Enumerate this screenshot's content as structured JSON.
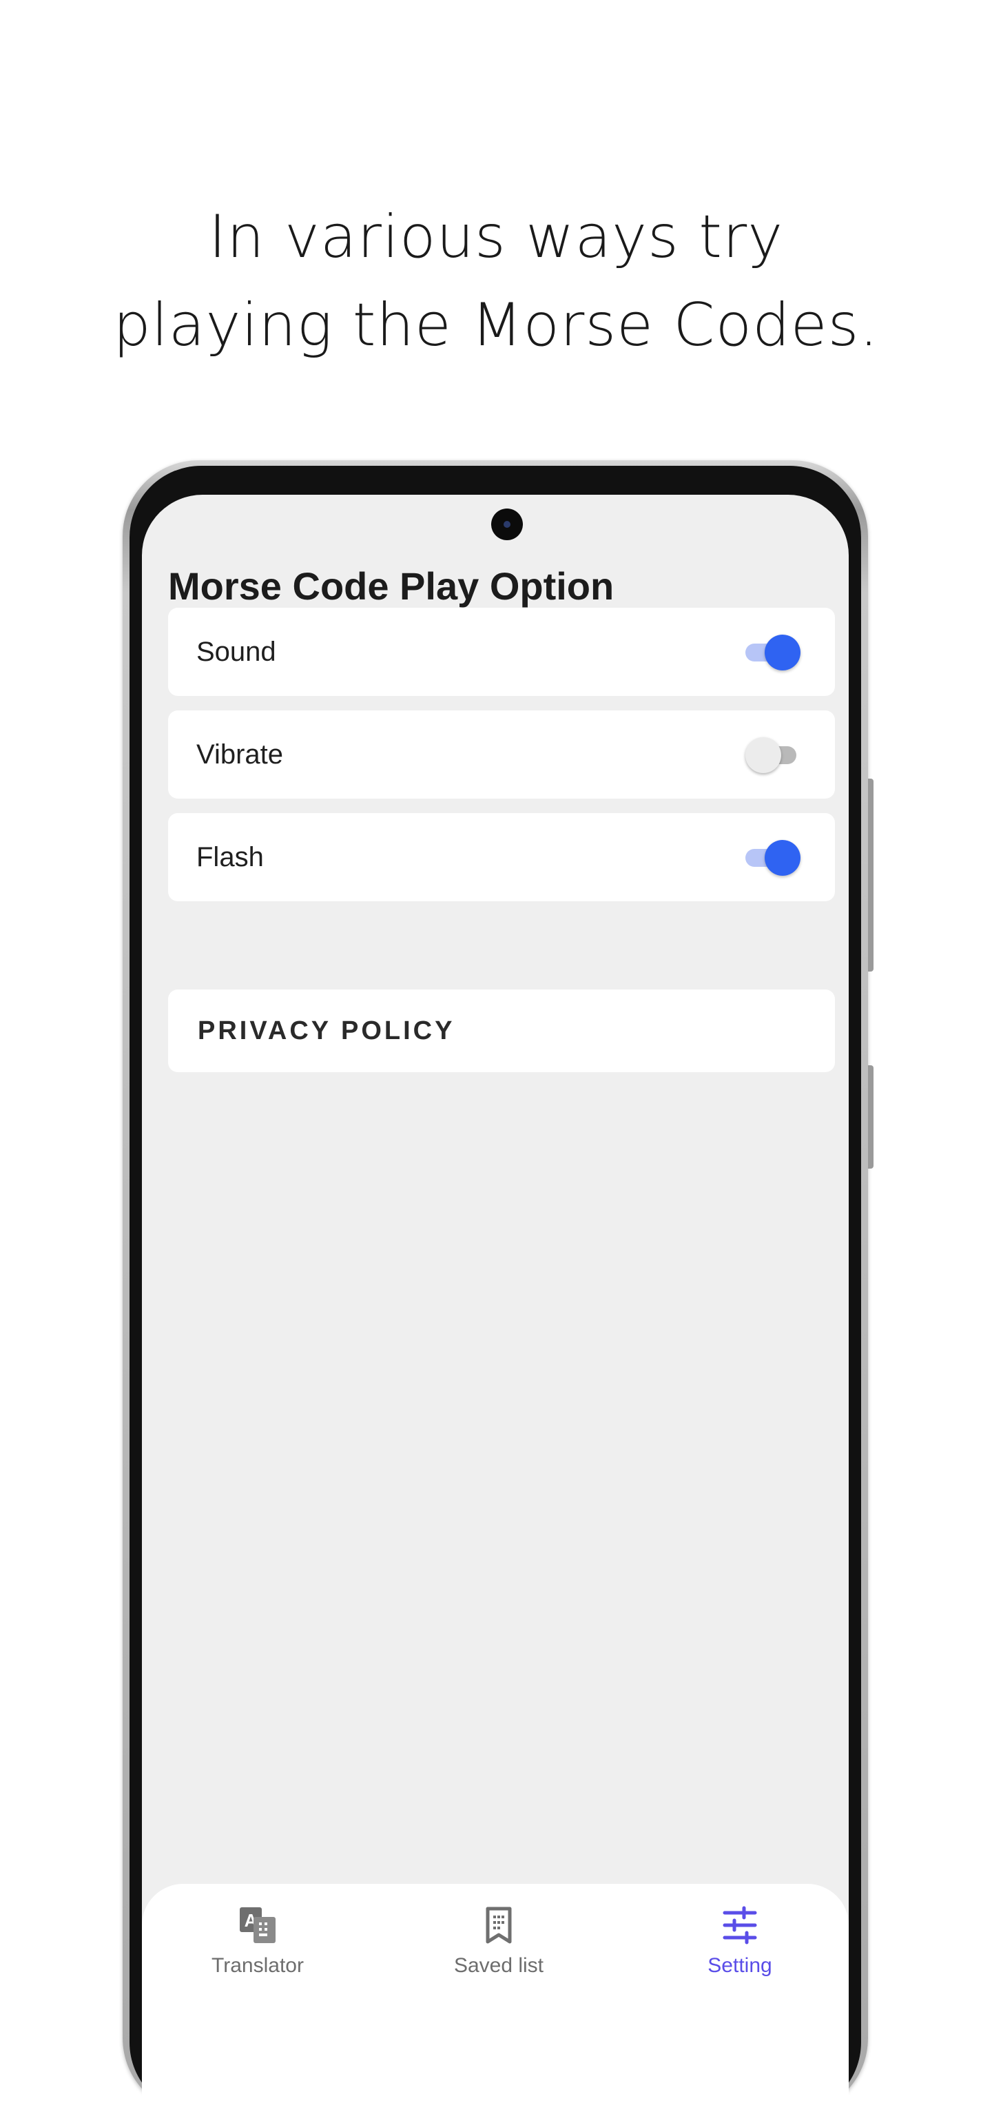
{
  "headline": {
    "line1": "In various ways try",
    "line2": "playing the Morse Codes."
  },
  "screen": {
    "title": "Morse Code Play Option",
    "options": [
      {
        "label": "Sound",
        "enabled": true
      },
      {
        "label": "Vibrate",
        "enabled": false
      },
      {
        "label": "Flash",
        "enabled": true
      }
    ],
    "privacy_label": "PRIVACY POLICY"
  },
  "bottom_nav": {
    "items": [
      {
        "label": "Translator",
        "icon": "translate-icon",
        "active": false
      },
      {
        "label": "Saved list",
        "icon": "bookmark-list-icon",
        "active": false
      },
      {
        "label": "Setting",
        "icon": "sliders-icon",
        "active": true
      }
    ]
  },
  "colors": {
    "accent": "#2f63f2",
    "nav_active": "#5a4de8",
    "background": "#efefef"
  }
}
